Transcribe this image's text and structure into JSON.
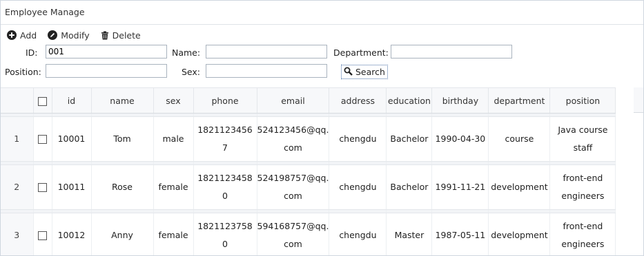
{
  "window": {
    "title": "Employee Manage"
  },
  "toolbar": {
    "add": "Add",
    "modify": "Modify",
    "delete": "Delete"
  },
  "form": {
    "id_label": "ID:",
    "id_value": "001",
    "name_label": "Name:",
    "name_value": "",
    "department_label": "Department:",
    "department_value": "",
    "position_label": "Position:",
    "position_value": "",
    "sex_label": "Sex:",
    "sex_value": "",
    "search_label": "Search"
  },
  "table": {
    "headers": [
      "id",
      "name",
      "sex",
      "phone",
      "email",
      "address",
      "education",
      "birthday",
      "department",
      "position"
    ],
    "rows": [
      {
        "num": "1",
        "id": "10001",
        "name": "Tom",
        "sex": "male",
        "phone_1": "1821123456",
        "phone_2": "7",
        "email_1": "524123456@qq.",
        "email_2": "com",
        "address": "chengdu",
        "education": "Bachelor",
        "birthday": "1990-04-30",
        "department": "course",
        "position_1": "Java course",
        "position_2": "staff"
      },
      {
        "num": "2",
        "id": "10011",
        "name": "Rose",
        "sex": "female",
        "phone_1": "1821123458",
        "phone_2": "0",
        "email_1": "524198757@qq.",
        "email_2": "com",
        "address": "chengdu",
        "education": "Bachelor",
        "birthday": "1991-11-21",
        "department": "development",
        "position_1": "front-end",
        "position_2": "engineers"
      },
      {
        "num": "3",
        "id": "10012",
        "name": "Anny",
        "sex": "female",
        "phone_1": "1821123758",
        "phone_2": "0",
        "email_1": "594168757@qq.",
        "email_2": "com",
        "address": "chengdu",
        "education": "Master",
        "birthday": "1987-05-11",
        "department": "development",
        "position_1": "front-end",
        "position_2": "engineers"
      }
    ]
  }
}
